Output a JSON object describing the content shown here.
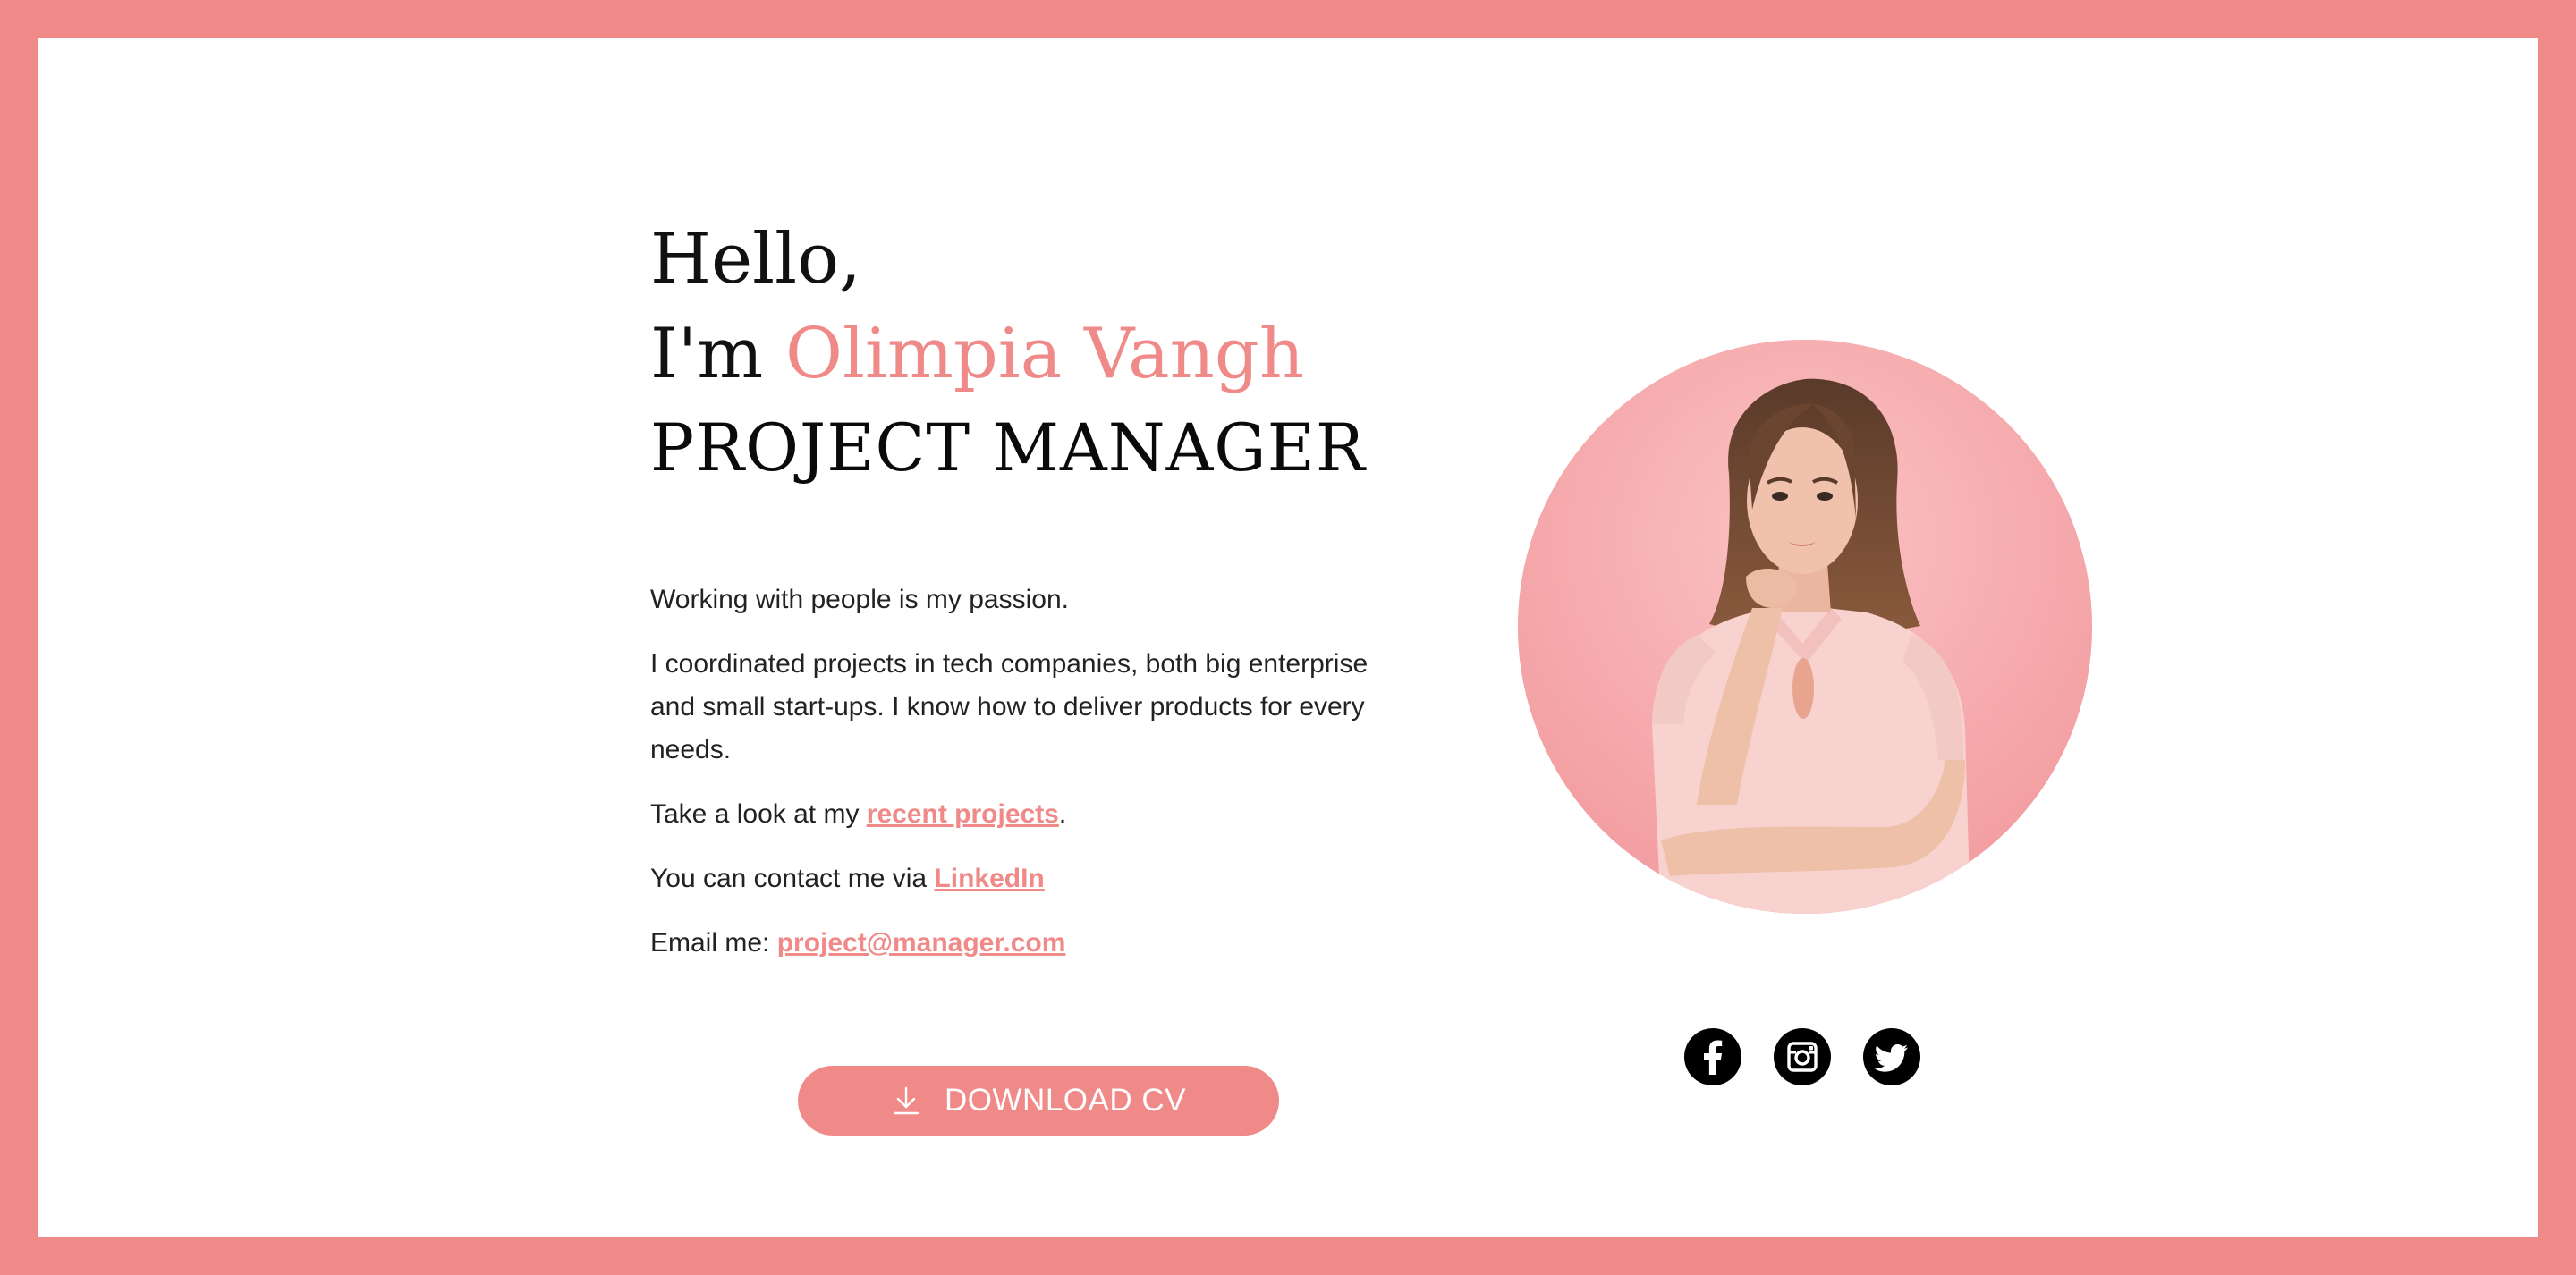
{
  "hero": {
    "greeting": "Hello,",
    "intro_prefix": "I'm",
    "name": "Olimpia Vangh",
    "role": "PROJECT MANAGER"
  },
  "bio": {
    "p1": "Working with people is my passion.",
    "p2": "I coordinated projects in tech companies, both big enterprise and small start-ups. I know how to deliver products for every needs.",
    "p3_prefix": "Take a look at my ",
    "p3_link": "recent projects",
    "p3_suffix": ".",
    "p4_prefix": "You can contact me via ",
    "p4_link": "LinkedIn",
    "p5_prefix": "Email me: ",
    "p5_link": "project@manager.com"
  },
  "cta": {
    "download_label": "DOWNLOAD CV",
    "icon": "download-icon"
  },
  "social": [
    {
      "icon": "facebook-icon"
    },
    {
      "icon": "instagram-icon"
    },
    {
      "icon": "twitter-icon"
    }
  ],
  "colors": {
    "accent": "#ef8a89",
    "border": "#ef8a89",
    "text": "#111111",
    "background": "#ffffff"
  }
}
